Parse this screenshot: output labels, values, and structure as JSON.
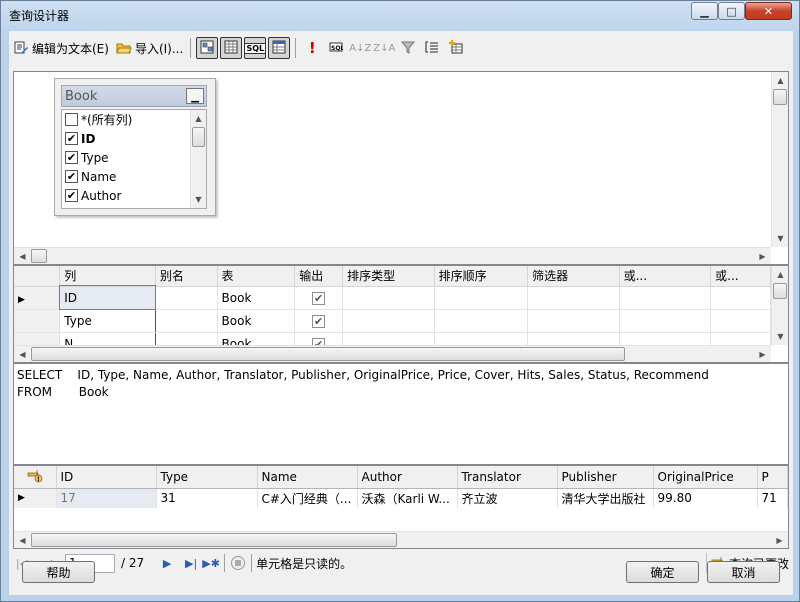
{
  "window": {
    "title": "查询设计器"
  },
  "toolbar": {
    "edit_as_text": "编辑为文本(E)",
    "import": "导入(I)...",
    "sql_label": "SQL"
  },
  "diagram": {
    "table_name": "Book",
    "columns": [
      {
        "label": "*(所有列)",
        "checked": false,
        "bold": false
      },
      {
        "label": "ID",
        "checked": true,
        "bold": true
      },
      {
        "label": "Type",
        "checked": true,
        "bold": false
      },
      {
        "label": "Name",
        "checked": true,
        "bold": false
      },
      {
        "label": "Author",
        "checked": true,
        "bold": false
      }
    ]
  },
  "grid": {
    "headers": [
      "列",
      "别名",
      "表",
      "输出",
      "排序类型",
      "排序顺序",
      "筛选器",
      "或...",
      "或..."
    ],
    "rows": [
      {
        "column": "ID",
        "alias": "",
        "table": "Book",
        "output": true
      },
      {
        "column": "Type",
        "alias": "",
        "table": "Book",
        "output": true
      },
      {
        "column": "N",
        "alias": "",
        "table": "Book",
        "output": true
      }
    ]
  },
  "sql": {
    "line1": "SELECT    ID, Type, Name, Author, Translator, Publisher, OriginalPrice, Price, Cover, Hits, Sales, Status, Recommend",
    "line2": "FROM       Book"
  },
  "results": {
    "headers": [
      "ID",
      "Type",
      "Name",
      "Author",
      "Translator",
      "Publisher",
      "OriginalPrice",
      "P"
    ],
    "rows": [
      [
        "17",
        "31",
        "C#入门经典（...",
        "沃森（Karli W...",
        "齐立波",
        "清华大学出版社",
        "99.80",
        "71"
      ]
    ]
  },
  "navigator": {
    "current_page": "1",
    "total": "/ 27",
    "status": "单元格是只读的。",
    "changed": "查询已更改"
  },
  "buttons": {
    "help": "帮助",
    "ok": "确定",
    "cancel": "取消"
  }
}
